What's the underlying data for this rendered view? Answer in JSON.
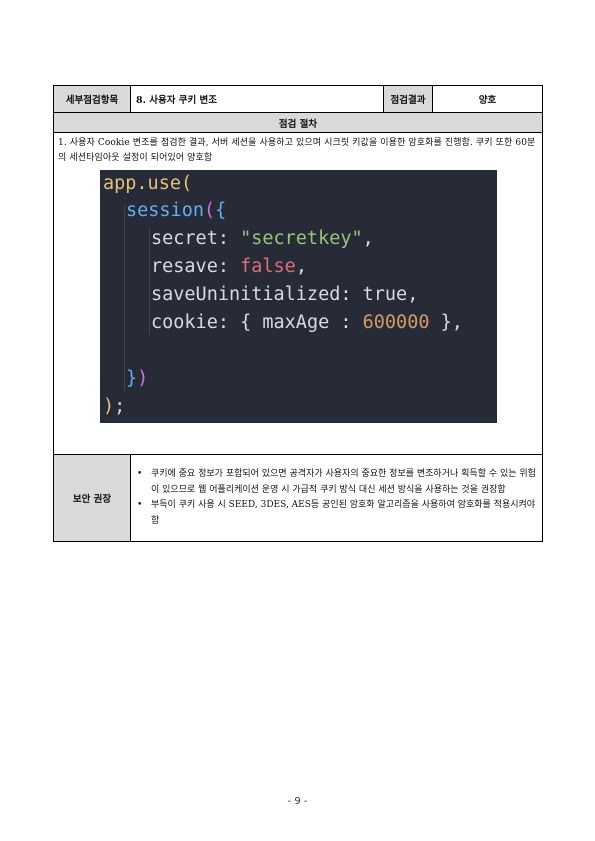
{
  "header": {
    "item_label": "세부점검항목",
    "item_value": "8. 사용자 쿠키 변조",
    "result_label": "점검결과",
    "result_value": "양호"
  },
  "procedure": {
    "title": "점검 절차",
    "description": "1. 사용자 Cookie 변조를 점검한 결과, 서버 세션을 사용하고 있으며 시크릿 키값을 이용한 암호화를 진행함. 쿠키 또한 60분의 세션타임아웃 설정이 되어있어 양호함"
  },
  "code": {
    "l1_fn": "app.use",
    "l1_paren": "(",
    "l2_fn": "session",
    "l2_paren": "(",
    "l2_brace": "{",
    "l3_key": "secret",
    "l3_colon": ": ",
    "l3_val": "\"secretkey\"",
    "l3_comma": ",",
    "l4_key": "resave",
    "l4_colon": ": ",
    "l4_val": "false",
    "l4_comma": ",",
    "l5_key": "saveUninitialized",
    "l5_colon": ": ",
    "l5_val": "true",
    "l5_comma": ",",
    "l6_key": "cookie",
    "l6_colon": ": ",
    "l6_open": "{ ",
    "l6_inner_key": "maxAge",
    "l6_inner_colon": " : ",
    "l6_num": "600000",
    "l6_close": " }",
    "l6_comma": ",",
    "l8_brace": "}",
    "l8_paren": ")",
    "l9_paren": ")",
    "l9_semi": ";"
  },
  "recommendation": {
    "label": "보안 권장",
    "bullet_char": "•",
    "items": [
      "쿠키에 중요 정보가 포함되어 있으면 공격자가 사용자의 중요한 정보를 변조하거나 획득할 수 있는 위험이 있으므로 웹 어플리케이션 운영 시 가급적 쿠키 방식 대신 세션 방식을 사용하는 것을 권장함",
      "부득이 쿠키 사용 시 SEED, 3DES, AES등 공인된 암호화 알고리즘을 사용하여 암호화를 적용시켜야 함"
    ]
  },
  "page_number": "- 9 -"
}
